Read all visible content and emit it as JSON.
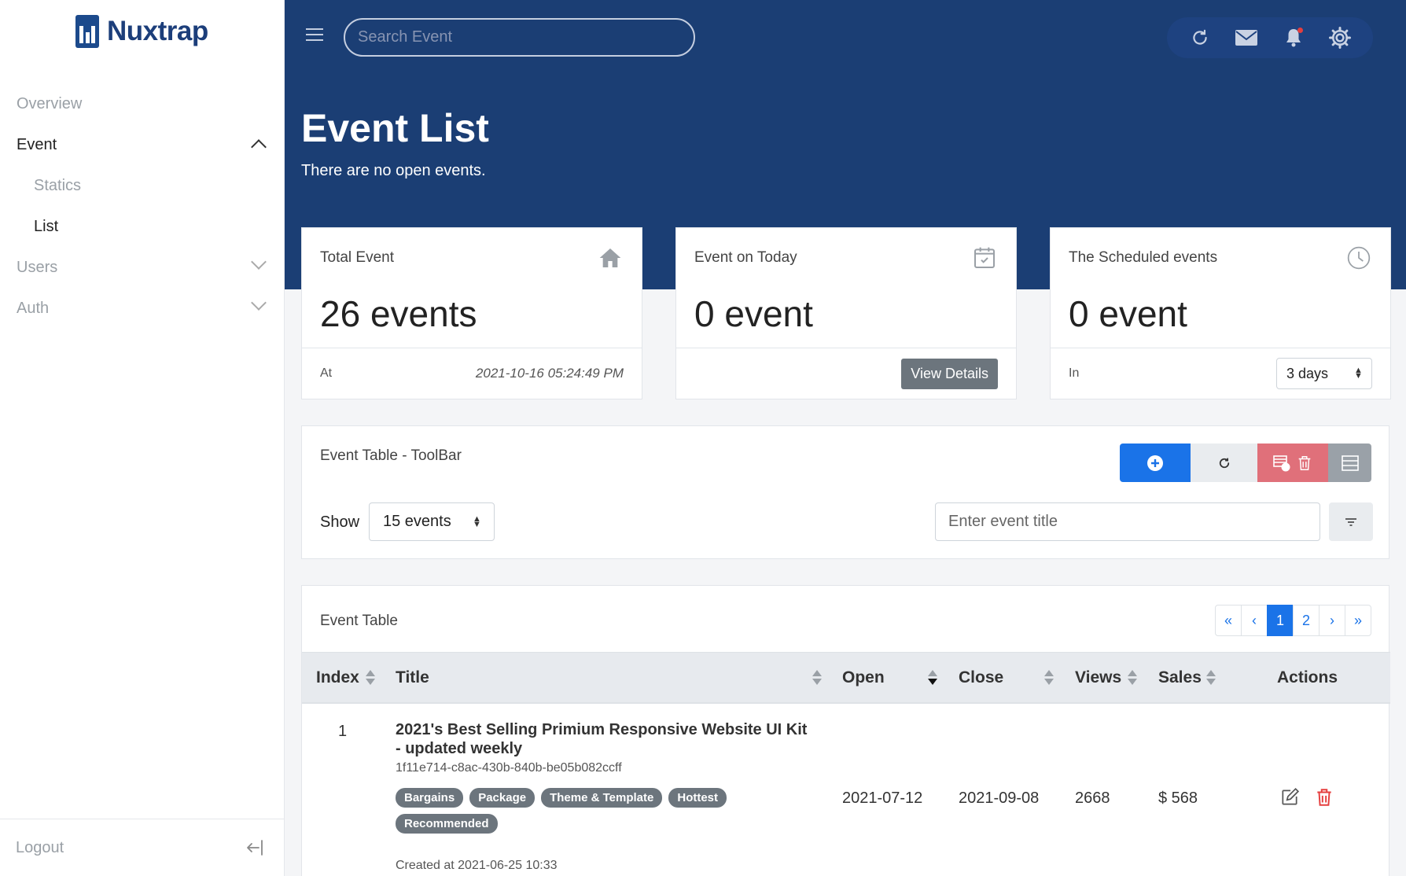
{
  "sidebar": {
    "brand": "Nuxtrap",
    "items": [
      {
        "label": "Overview"
      },
      {
        "label": "Event"
      },
      {
        "label": "Statics"
      },
      {
        "label": "List"
      },
      {
        "label": "Users"
      },
      {
        "label": "Auth"
      }
    ],
    "logout": "Logout"
  },
  "header": {
    "search_placeholder": "Search Event",
    "title": "Event List",
    "subtitle": "There are no open events."
  },
  "stats": [
    {
      "label": "Total Event",
      "value": "26 events",
      "foot_label": "At",
      "foot_value": "2021-10-16 05:24:49 PM",
      "icon": "home-icon"
    },
    {
      "label": "Event on Today",
      "value": "0 event",
      "button": "View Details",
      "icon": "calendar-icon"
    },
    {
      "label": "The Scheduled events",
      "value": "0 event",
      "foot_label": "In",
      "select_value": "3 days",
      "icon": "clock-icon"
    }
  ],
  "toolbar": {
    "title": "Event Table - ToolBar",
    "show_label": "Show",
    "show_value": "15 events",
    "search_placeholder": "Enter event title"
  },
  "table": {
    "title": "Event Table",
    "pager": [
      "«",
      "‹",
      "1",
      "2",
      "›",
      "»"
    ],
    "columns": [
      "Index",
      "Title",
      "Open",
      "Close",
      "Views",
      "Sales",
      "Actions"
    ],
    "rows": [
      {
        "index": "1",
        "title": "2021's Best Selling Primium Responsive Website UI Kit - updated weekly",
        "uuid": "1f11e714-c8ac-430b-840b-be05b082ccff",
        "tags": [
          "Bargains",
          "Package",
          "Theme & Template",
          "Hottest",
          "Recommended"
        ],
        "created": "Created at 2021-06-25 10:33",
        "open": "2021-07-12",
        "close": "2021-09-08",
        "views": "2668",
        "sales": "$ 568"
      }
    ]
  },
  "colors": {
    "header_bg": "#1b3e74",
    "primary": "#1a73e8",
    "danger": "#e0707a",
    "secondary": "#6c757d"
  }
}
